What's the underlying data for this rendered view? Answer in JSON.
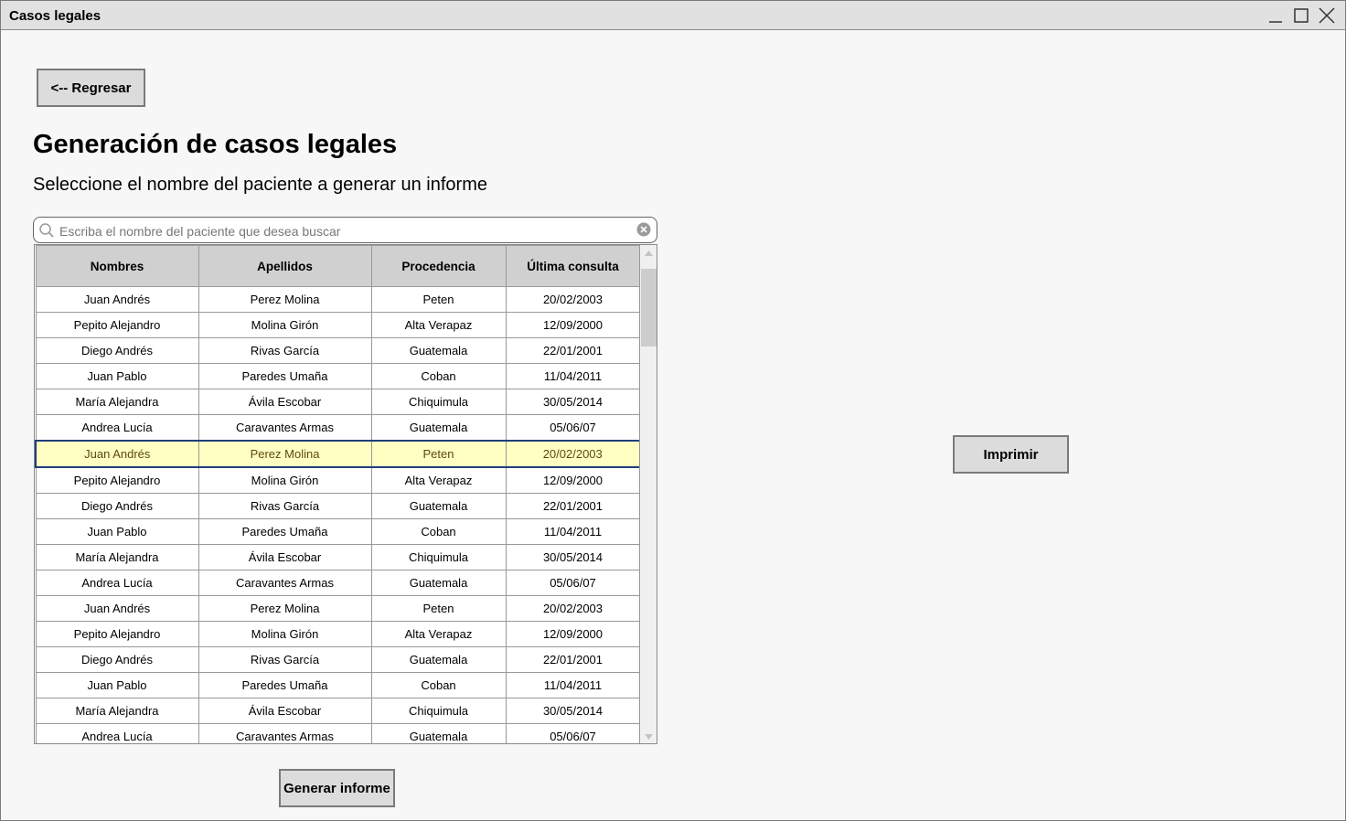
{
  "window": {
    "title": "Casos legales"
  },
  "back_button": {
    "label": "<-- Regresar"
  },
  "heading": "Generación de casos legales",
  "subtitle": "Seleccione el nombre del paciente a generar un informe",
  "search": {
    "placeholder": "Escriba el nombre del paciente que desea buscar"
  },
  "table": {
    "columns": [
      "Nombres",
      "Apellidos",
      "Procedencia",
      "Última consulta"
    ],
    "selected_row": 6,
    "rows": [
      [
        "Juan Andrés",
        "Perez Molina",
        "Peten",
        "20/02/2003"
      ],
      [
        "Pepito Alejandro",
        "Molina Girón",
        "Alta Verapaz",
        "12/09/2000"
      ],
      [
        "Diego Andrés",
        "Rivas García",
        "Guatemala",
        "22/01/2001"
      ],
      [
        "Juan Pablo",
        "Paredes Umaña",
        "Coban",
        "11/04/2011"
      ],
      [
        "María Alejandra",
        "Ávila Escobar",
        "Chiquimula",
        "30/05/2014"
      ],
      [
        "Andrea Lucía",
        "Caravantes Armas",
        "Guatemala",
        "05/06/07"
      ],
      [
        "Juan Andrés",
        "Perez Molina",
        "Peten",
        "20/02/2003"
      ],
      [
        "Pepito Alejandro",
        "Molina Girón",
        "Alta Verapaz",
        "12/09/2000"
      ],
      [
        "Diego Andrés",
        "Rivas García",
        "Guatemala",
        "22/01/2001"
      ],
      [
        "Juan Pablo",
        "Paredes Umaña",
        "Coban",
        "11/04/2011"
      ],
      [
        "María Alejandra",
        "Ávila Escobar",
        "Chiquimula",
        "30/05/2014"
      ],
      [
        "Andrea Lucía",
        "Caravantes Armas",
        "Guatemala",
        "05/06/07"
      ],
      [
        "Juan Andrés",
        "Perez Molina",
        "Peten",
        "20/02/2003"
      ],
      [
        "Pepito Alejandro",
        "Molina Girón",
        "Alta Verapaz",
        "12/09/2000"
      ],
      [
        "Diego Andrés",
        "Rivas García",
        "Guatemala",
        "22/01/2001"
      ],
      [
        "Juan Pablo",
        "Paredes Umaña",
        "Coban",
        "11/04/2011"
      ],
      [
        "María Alejandra",
        "Ávila Escobar",
        "Chiquimula",
        "30/05/2014"
      ],
      [
        "Andrea Lucía",
        "Caravantes Armas",
        "Guatemala",
        "05/06/07"
      ]
    ]
  },
  "generate_button": {
    "label": "Generar informe"
  },
  "print_button": {
    "label": "Imprimir"
  },
  "icons": {
    "minimize": "minimize-icon",
    "maximize": "maximize-icon",
    "close": "close-icon",
    "search": "search-icon",
    "clear": "clear-circle-icon"
  },
  "colors": {
    "selection_fill": "#ffffc4",
    "selection_border": "#1f3e7a",
    "header_fill": "#d0d0d0",
    "button_fill": "#dcdcdc"
  }
}
